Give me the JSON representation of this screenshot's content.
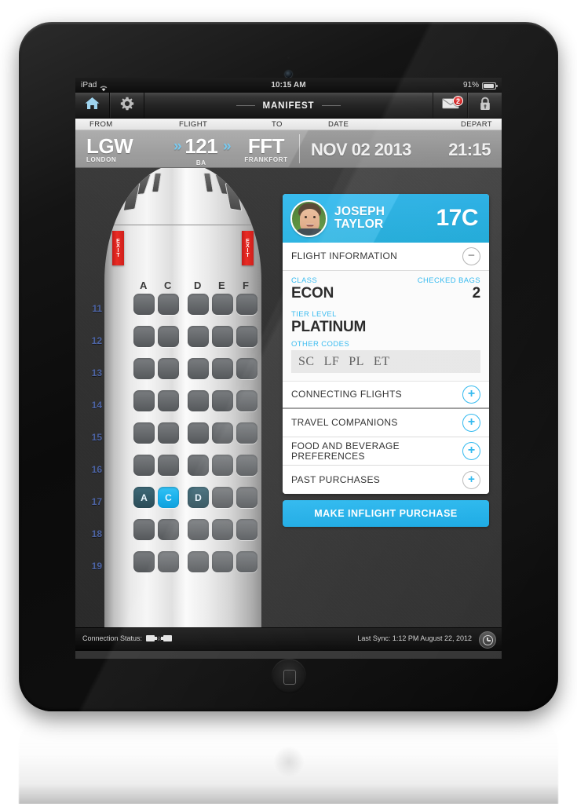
{
  "device": {
    "label": "ipad-frame"
  },
  "status_bar": {
    "carrier": "iPad",
    "wifi_icon": "wifi-icon",
    "time": "10:15 AM",
    "battery_percent": "91%",
    "battery_icon": "battery-icon"
  },
  "navbar": {
    "home_icon": "home-icon",
    "settings_icon": "gear-icon",
    "title": "MANIFEST",
    "mail_icon": "mail-icon",
    "mail_badge": "2",
    "lock_icon": "lock-icon"
  },
  "flight_bar": {
    "labels": {
      "from": "FROM",
      "flight": "FLIGHT",
      "to": "TO",
      "date": "DATE",
      "depart": "DEPART"
    },
    "values": {
      "from_code": "LGW",
      "from_city": "LONDON",
      "flight_number": "121",
      "carrier": "BA",
      "chevron_left": "»",
      "chevron_right": "»",
      "to_code": "FFT",
      "to_city": "FRANKFORT",
      "date": "NOV 02 2013",
      "depart": "21:15"
    }
  },
  "seatmap": {
    "exit_label": "EXIT",
    "columns": [
      "A",
      "C",
      "D",
      "E",
      "F"
    ],
    "rows": [
      {
        "number": "11",
        "seats": [
          {
            "col": "A",
            "state": "free",
            "label": ""
          },
          {
            "col": "C",
            "state": "free",
            "label": ""
          },
          {
            "col": "D",
            "state": "free",
            "label": ""
          },
          {
            "col": "E",
            "state": "free",
            "label": ""
          },
          {
            "col": "F",
            "state": "free",
            "label": ""
          }
        ]
      },
      {
        "number": "12",
        "seats": [
          {
            "col": "A",
            "state": "free",
            "label": ""
          },
          {
            "col": "C",
            "state": "free",
            "label": ""
          },
          {
            "col": "D",
            "state": "free",
            "label": ""
          },
          {
            "col": "E",
            "state": "free",
            "label": ""
          },
          {
            "col": "F",
            "state": "free",
            "label": ""
          }
        ]
      },
      {
        "number": "13",
        "seats": [
          {
            "col": "A",
            "state": "free",
            "label": ""
          },
          {
            "col": "C",
            "state": "free",
            "label": ""
          },
          {
            "col": "D",
            "state": "free",
            "label": ""
          },
          {
            "col": "E",
            "state": "free",
            "label": ""
          },
          {
            "col": "F",
            "state": "free",
            "label": ""
          }
        ]
      },
      {
        "number": "14",
        "seats": [
          {
            "col": "A",
            "state": "free",
            "label": ""
          },
          {
            "col": "C",
            "state": "free",
            "label": ""
          },
          {
            "col": "D",
            "state": "free",
            "label": ""
          },
          {
            "col": "E",
            "state": "free",
            "label": ""
          },
          {
            "col": "F",
            "state": "free",
            "label": ""
          }
        ]
      },
      {
        "number": "15",
        "seats": [
          {
            "col": "A",
            "state": "free",
            "label": ""
          },
          {
            "col": "C",
            "state": "free",
            "label": ""
          },
          {
            "col": "D",
            "state": "free",
            "label": ""
          },
          {
            "col": "E",
            "state": "free",
            "label": ""
          },
          {
            "col": "F",
            "state": "free",
            "label": ""
          }
        ]
      },
      {
        "number": "16",
        "seats": [
          {
            "col": "A",
            "state": "free",
            "label": ""
          },
          {
            "col": "C",
            "state": "free",
            "label": ""
          },
          {
            "col": "D",
            "state": "free",
            "label": ""
          },
          {
            "col": "E",
            "state": "free",
            "label": ""
          },
          {
            "col": "F",
            "state": "free",
            "label": ""
          }
        ]
      },
      {
        "number": "17",
        "seats": [
          {
            "col": "A",
            "state": "group",
            "label": "A"
          },
          {
            "col": "C",
            "state": "selected",
            "label": "C"
          },
          {
            "col": "D",
            "state": "group",
            "label": "D"
          },
          {
            "col": "E",
            "state": "free",
            "label": ""
          },
          {
            "col": "F",
            "state": "free",
            "label": ""
          }
        ]
      },
      {
        "number": "18",
        "seats": [
          {
            "col": "A",
            "state": "free",
            "label": ""
          },
          {
            "col": "C",
            "state": "free",
            "label": ""
          },
          {
            "col": "D",
            "state": "free",
            "label": ""
          },
          {
            "col": "E",
            "state": "free",
            "label": ""
          },
          {
            "col": "F",
            "state": "free",
            "label": ""
          }
        ]
      },
      {
        "number": "19",
        "seats": [
          {
            "col": "A",
            "state": "free",
            "label": ""
          },
          {
            "col": "C",
            "state": "free",
            "label": ""
          },
          {
            "col": "D",
            "state": "free",
            "label": ""
          },
          {
            "col": "E",
            "state": "free",
            "label": ""
          },
          {
            "col": "F",
            "state": "free",
            "label": ""
          }
        ]
      }
    ]
  },
  "passenger_card": {
    "first_name": "JOSEPH",
    "last_name": "TAYLOR",
    "seat": "17C",
    "avatar_icon": "avatar-photo",
    "flight_information": {
      "title": "FLIGHT INFORMATION",
      "toggle_icon": "minus-icon",
      "class_label": "CLASS",
      "class_value": "ECON",
      "checked_bags_label": "CHECKED BAGS",
      "checked_bags_value": "2",
      "tier_label": "TIER LEVEL",
      "tier_value": "PLATINUM",
      "other_codes_label": "OTHER CODES",
      "other_codes": [
        "SC",
        "LF",
        "PL",
        "ET"
      ]
    },
    "sections": [
      {
        "title": "CONNECTING FLIGHTS",
        "toggle_icon": "plus-icon",
        "style": "blue"
      },
      {
        "title": "TRAVEL COMPANIONS",
        "toggle_icon": "plus-icon",
        "style": "blue"
      },
      {
        "title": "FOOD AND BEVERAGE PREFERENCES",
        "toggle_icon": "plus-icon",
        "style": "blue"
      },
      {
        "title": "PAST PURCHASES",
        "toggle_icon": "plus-icon",
        "style": "gray"
      }
    ],
    "cta_label": "MAKE INFLIGHT PURCHASE"
  },
  "bottom_bar": {
    "connection_label": "Connection Status:",
    "connection_icon": "plug-connected-icon",
    "last_sync": "Last Sync: 1:12 PM August 22, 2012",
    "sync_icon": "clock-icon"
  },
  "colors": {
    "accent_cyan": "#1cb0e6",
    "badge_red": "#d42020",
    "exit_red": "#ea2c25",
    "seat_selected": "#1cb2ec",
    "seat_group": "#345a67",
    "row_number": "#4c63a3"
  }
}
